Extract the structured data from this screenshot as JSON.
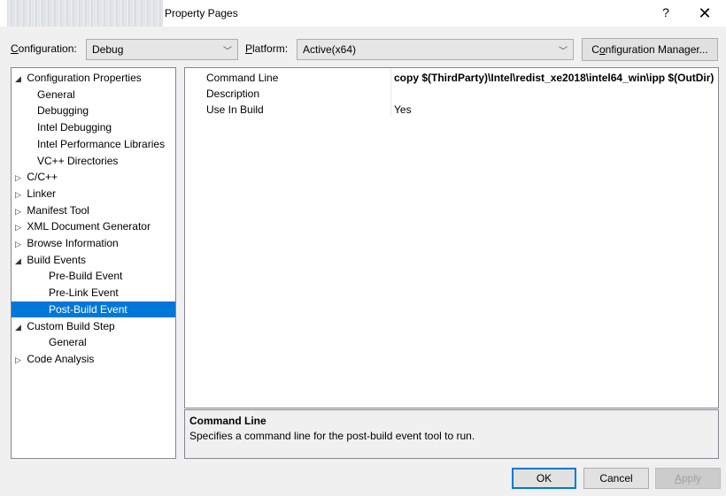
{
  "window": {
    "title": "Property Pages",
    "help_label": "?",
    "close_label": "✕"
  },
  "toolbar": {
    "configuration_label": "onfiguration:",
    "configuration_label_accel": "C",
    "configuration_value": "Debug",
    "platform_label_accel": "P",
    "platform_label": "latform:",
    "platform_value": "Active(x64)",
    "config_manager_accel_pre": "C",
    "config_manager_accel": "o",
    "config_manager_rest": "nfiguration Manager..."
  },
  "tree": {
    "items": [
      {
        "label": "Configuration Properties",
        "glyph": "◢",
        "level": 0
      },
      {
        "label": "General",
        "glyph": "",
        "level": 1
      },
      {
        "label": "Debugging",
        "glyph": "",
        "level": 1
      },
      {
        "label": "Intel Debugging",
        "glyph": "",
        "level": 1
      },
      {
        "label": "Intel Performance Libraries",
        "glyph": "",
        "level": 1
      },
      {
        "label": "VC++ Directories",
        "glyph": "",
        "level": 1
      },
      {
        "label": "C/C++",
        "glyph": "▷",
        "level": 0
      },
      {
        "label": "Linker",
        "glyph": "▷",
        "level": 0
      },
      {
        "label": "Manifest Tool",
        "glyph": "▷",
        "level": 0
      },
      {
        "label": "XML Document Generator",
        "glyph": "▷",
        "level": 0
      },
      {
        "label": "Browse Information",
        "glyph": "▷",
        "level": 0
      },
      {
        "label": "Build Events",
        "glyph": "◢",
        "level": 0
      },
      {
        "label": "Pre-Build Event",
        "glyph": "",
        "level": 2
      },
      {
        "label": "Pre-Link Event",
        "glyph": "",
        "level": 2
      },
      {
        "label": "Post-Build Event",
        "glyph": "",
        "level": 2,
        "selected": true
      },
      {
        "label": "Custom Build Step",
        "glyph": "◢",
        "level": 0
      },
      {
        "label": "General",
        "glyph": "",
        "level": 2
      },
      {
        "label": "Code Analysis",
        "glyph": "▷",
        "level": 0
      }
    ]
  },
  "grid": {
    "rows": [
      {
        "name": "Command Line",
        "value": "copy $(ThirdParty)\\Intel\\redist_xe2018\\intel64_win\\ipp $(OutDir)",
        "bold": true
      },
      {
        "name": "Description",
        "value": "",
        "bold": false
      },
      {
        "name": "Use In Build",
        "value": "Yes",
        "bold": false
      }
    ]
  },
  "description": {
    "title": "Command Line",
    "text": "Specifies a command line for the post-build event tool to run."
  },
  "buttons": {
    "ok": "OK",
    "cancel": "Cancel",
    "apply_accel": "A",
    "apply_rest": "pply"
  }
}
